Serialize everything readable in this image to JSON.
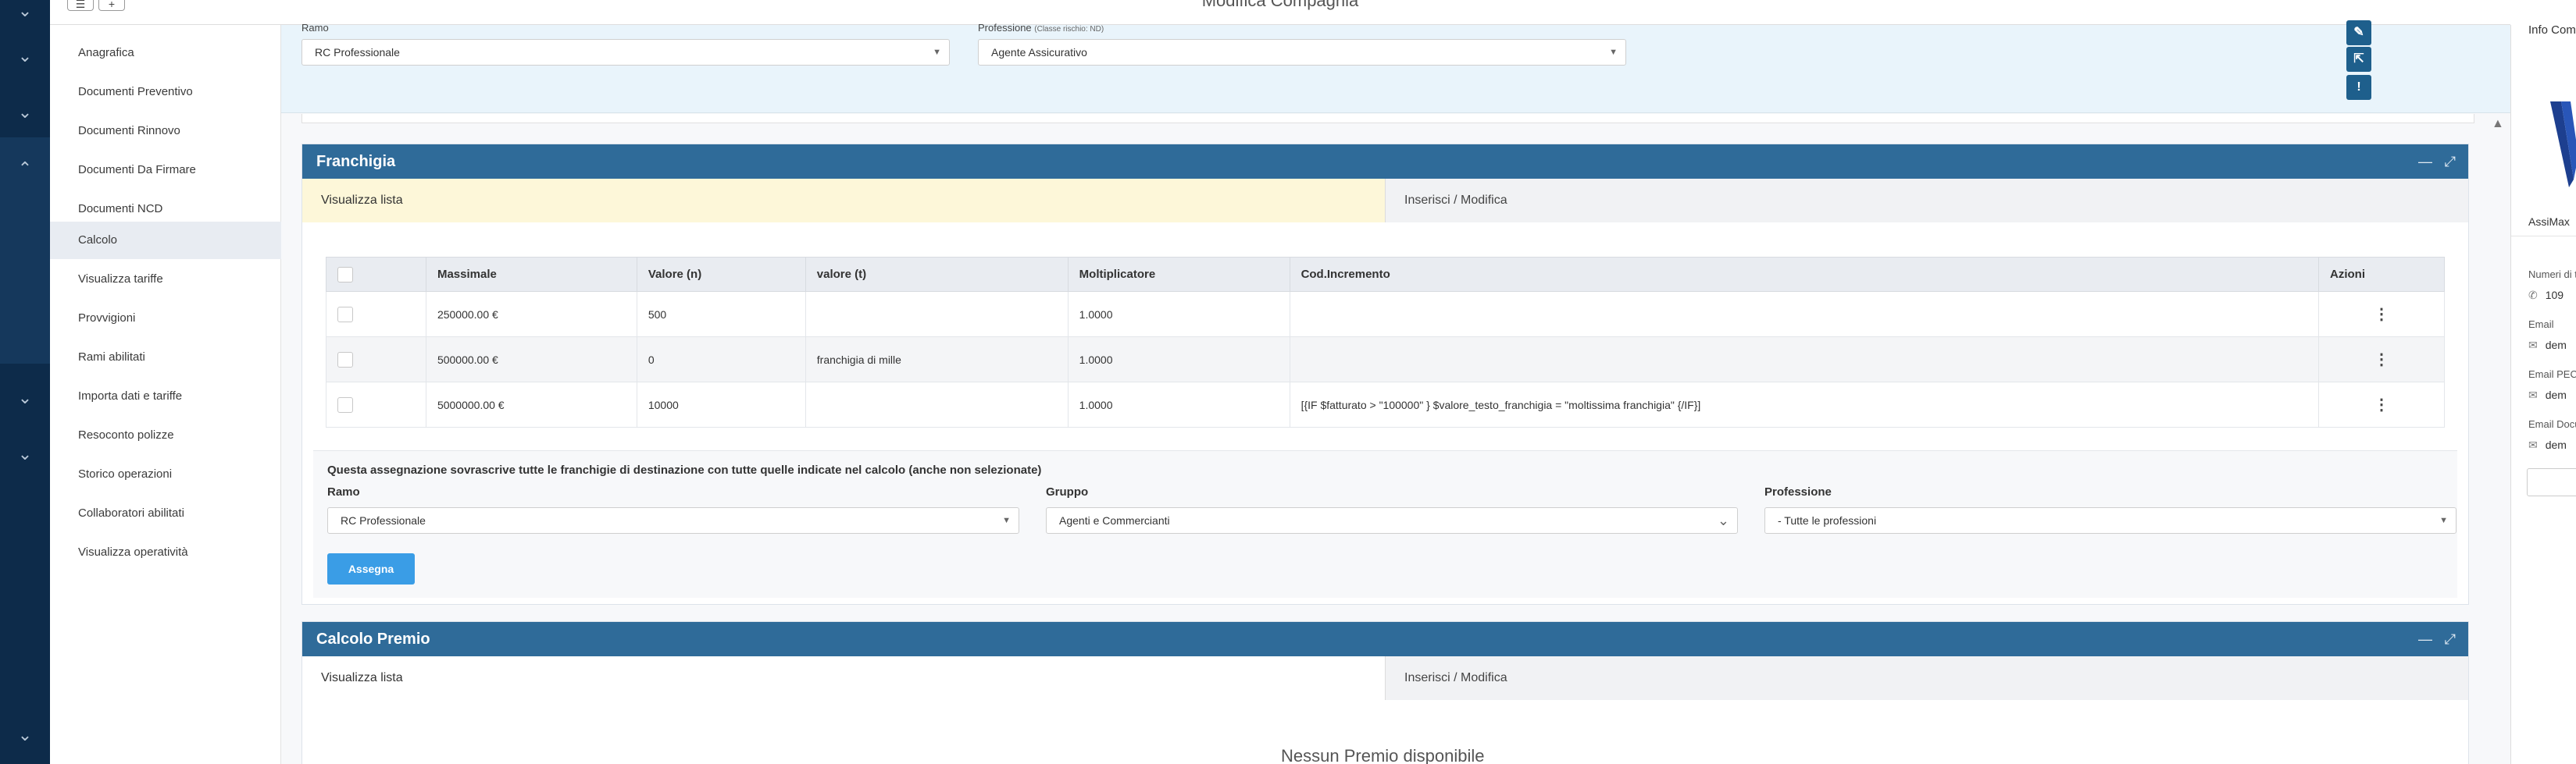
{
  "header": {
    "title": "Modifica Compagnia",
    "menu_icon": "hamburger-icon",
    "add_icon": "plus-icon"
  },
  "sidebar": {
    "items": [
      {
        "label": "Anagrafica"
      },
      {
        "label": "Documenti Preventivo"
      },
      {
        "label": "Documenti Rinnovo"
      },
      {
        "label": "Documenti Da Firmare"
      },
      {
        "label": "Documenti NCD"
      },
      {
        "label": "Calcolo",
        "active": true
      },
      {
        "label": "Visualizza tariffe"
      },
      {
        "label": "Provvigioni"
      },
      {
        "label": "Rami abilitati"
      },
      {
        "label": "Importa dati e tariffe"
      },
      {
        "label": "Resoconto polizze"
      },
      {
        "label": "Storico operazioni"
      },
      {
        "label": "Collaboratori abilitati"
      },
      {
        "label": "Visualizza operatività"
      }
    ]
  },
  "filters": {
    "ramo_label": "Ramo",
    "ramo_value": "RC Professionale",
    "professione_label": "Professione",
    "professione_hint": "(Classe rischio: ND)",
    "professione_value": "Agente Assicurativo",
    "action_icons": [
      "edit-icon",
      "external-link-icon",
      "info-icon"
    ]
  },
  "franchigia": {
    "title": "Franchigia",
    "tabs": {
      "list": "Visualizza lista",
      "edit": "Inserisci / Modifica"
    },
    "table": {
      "headers": [
        "Massimale",
        "Valore (n)",
        "valore (t)",
        "Moltiplicatore",
        "Cod.Incremento",
        "Azioni"
      ],
      "rows": [
        {
          "massimale": "250000.00 €",
          "valore_n": "500",
          "valore_t": "",
          "moltiplicatore": "1.0000",
          "cod_incremento": ""
        },
        {
          "massimale": "500000.00 €",
          "valore_n": "0",
          "valore_t": "franchigia di mille",
          "moltiplicatore": "1.0000",
          "cod_incremento": ""
        },
        {
          "massimale": "5000000.00 €",
          "valore_n": "10000",
          "valore_t": "",
          "moltiplicatore": "1.0000",
          "cod_incremento": "[{IF $fatturato > \"100000\" } $valore_testo_franchigia = \"moltissima franchigia\" {/IF}]"
        }
      ]
    },
    "assign": {
      "note": "Questa assegnazione sovrascrive tutte le franchigie di destinazione con tutte quelle indicate nel calcolo (anche non selezionate)",
      "ramo_label": "Ramo",
      "ramo_value": "RC Professionale",
      "gruppo_label": "Gruppo",
      "gruppo_value": "Agenti e Commercianti",
      "professione_label": "Professione",
      "professione_value": "- Tutte le professioni",
      "button": "Assegna"
    }
  },
  "calcolo_premio": {
    "title": "Calcolo Premio",
    "tabs": {
      "list": "Visualizza lista",
      "edit": "Inserisci / Modifica"
    }
  },
  "footer_partial": "Nessun Premio disponibile",
  "right_panel": {
    "title": "Info Compagnia",
    "company": "AssiMax",
    "phone_label": "Numeri di telefono",
    "phone_value": "109",
    "email_label": "Email",
    "email_value": "dem",
    "pec_label": "Email PEC",
    "pec_value": "dem",
    "doc_label": "Email Documenti",
    "doc_value": "dem"
  },
  "colors": {
    "rail": "#0d2b4a",
    "panel_header": "#2f6b99",
    "active_tab": "#fdf7d9",
    "filter_bg": "#e9f4fb",
    "primary_button": "#3a9de6"
  }
}
